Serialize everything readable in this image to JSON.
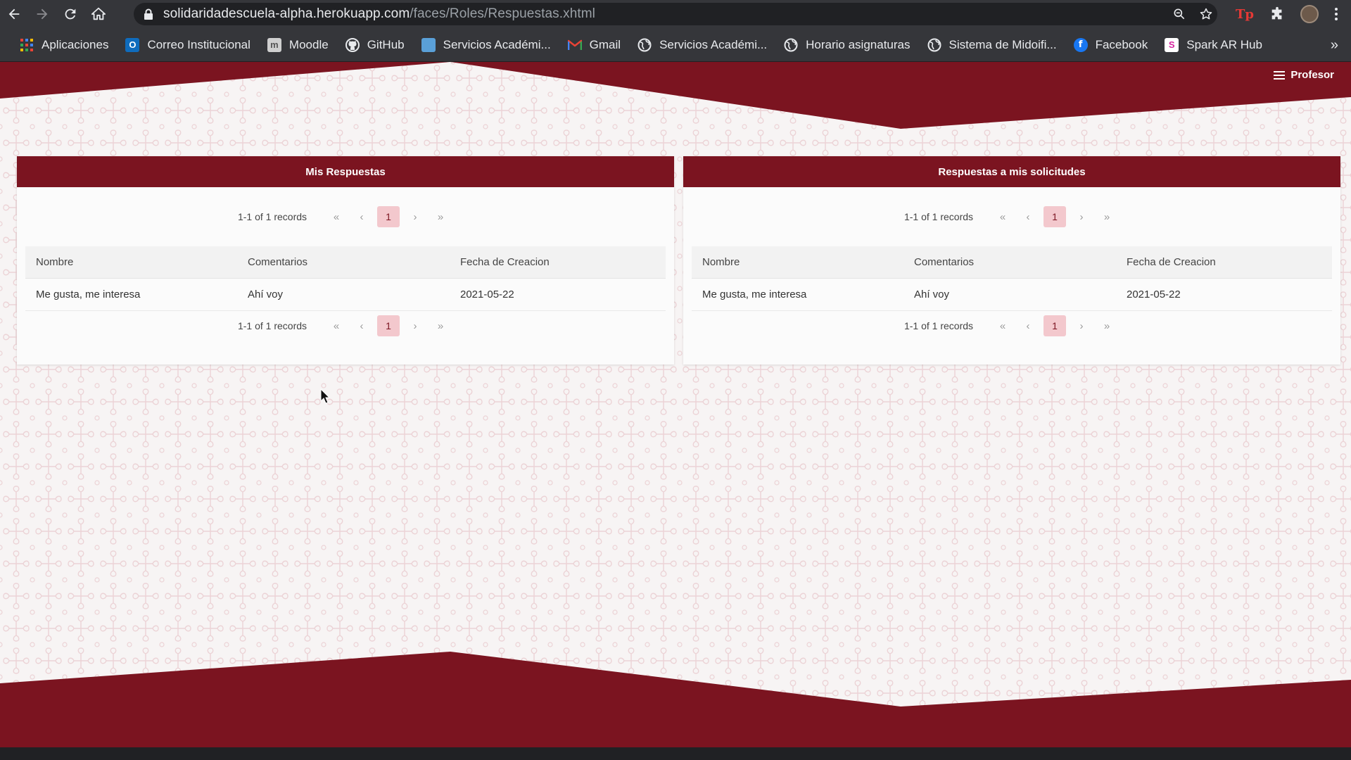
{
  "browser": {
    "url_host": "solidaridadescuela-alpha.herokuapp.com",
    "url_path": "/faces/Roles/Respuestas.xhtml",
    "extension_label": "Tp",
    "bookmarks": [
      {
        "label": "Aplicaciones",
        "icon": "apps-grid-icon"
      },
      {
        "label": "Correo Institucional",
        "icon": "outlook-icon"
      },
      {
        "label": "Moodle",
        "icon": "moodle-icon"
      },
      {
        "label": "GitHub",
        "icon": "github-icon"
      },
      {
        "label": "Servicios Académi...",
        "icon": "services-icon"
      },
      {
        "label": "Gmail",
        "icon": "gmail-icon"
      },
      {
        "label": "Servicios Académi...",
        "icon": "globe-icon"
      },
      {
        "label": "Horario asignaturas",
        "icon": "globe-icon"
      },
      {
        "label": "Sistema de Midoifi...",
        "icon": "globe-icon"
      },
      {
        "label": "Facebook",
        "icon": "facebook-icon"
      },
      {
        "label": "Spark AR Hub",
        "icon": "spark-ar-icon"
      }
    ],
    "more_bookmarks": "»"
  },
  "app": {
    "menu_label": "Profesor",
    "theme_color": "#7b1420"
  },
  "panels": [
    {
      "title": "Mis Respuestas",
      "records_label": "1-1 of 1 records",
      "current_page": "1",
      "columns": [
        "Nombre",
        "Comentarios",
        "Fecha de Creacion"
      ],
      "rows": [
        [
          "Me gusta, me interesa",
          "Ahí voy",
          "2021-05-22"
        ]
      ]
    },
    {
      "title": "Respuestas a mis solicitudes",
      "records_label": "1-1 of 1 records",
      "current_page": "1",
      "columns": [
        "Nombre",
        "Comentarios",
        "Fecha de Creacion"
      ],
      "rows": [
        [
          "Me gusta, me interesa",
          "Ahí voy",
          "2021-05-22"
        ]
      ]
    }
  ],
  "paginator_glyphs": {
    "first": "«",
    "prev": "‹",
    "next": "›",
    "last": "»"
  }
}
